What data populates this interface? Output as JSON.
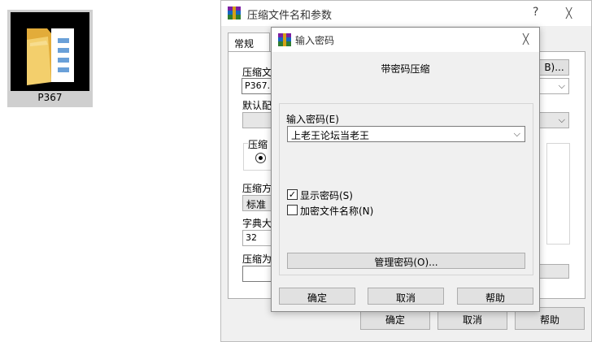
{
  "desktop": {
    "folder_label": "P367"
  },
  "back_window": {
    "title": "压缩文件名和参数",
    "help_glyph": "?",
    "close_glyph": "╳",
    "tab_general": "常规",
    "archive_name_label": "压缩文",
    "archive_name_value": "P367.r",
    "browse_label": "B)...",
    "profile_label": "默认配",
    "format_label": "压缩",
    "method_label": "压缩方",
    "method_value": "标准",
    "dict_label": "字典大",
    "dict_value": "32",
    "split_label": "压缩为",
    "ok": "确定",
    "cancel": "取消",
    "help": "帮助"
  },
  "dialog": {
    "title": "输入密码",
    "close_glyph": "╳",
    "heading": "带密码压缩",
    "password_label": "输入密码(E)",
    "password_value": "上老王论坛当老王",
    "show_password": {
      "label": "显示密码(S)",
      "checked": true
    },
    "encrypt_names": {
      "label": "加密文件名称(N)",
      "checked": false
    },
    "manage_button": "管理密码(O)...",
    "ok": "确定",
    "cancel": "取消",
    "help": "帮助"
  },
  "colors": {
    "folder": "#f3cf6c",
    "folder_dark": "#e2ac3a",
    "window_bg": "#f0f0f0",
    "button_bg": "#e1e1e1"
  },
  "icons": {
    "folder": "folder-icon",
    "app": "winrar-icon",
    "chevron": "chevron-down-icon"
  }
}
